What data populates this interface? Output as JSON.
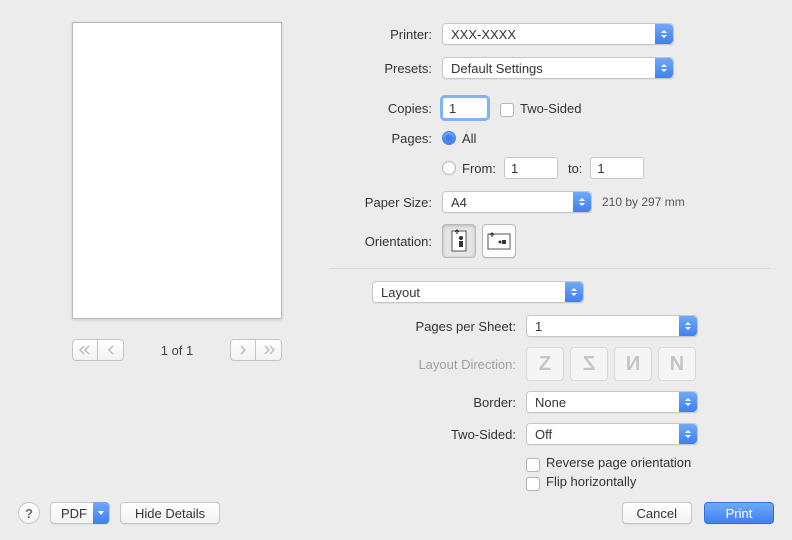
{
  "labels": {
    "printer": "Printer:",
    "presets": "Presets:",
    "copies": "Copies:",
    "two_sided_cb": "Two-Sided",
    "pages": "Pages:",
    "all": "All",
    "from": "From:",
    "to": "to:",
    "paper_size": "Paper Size:",
    "orientation": "Orientation:",
    "pages_per_sheet": "Pages per Sheet:",
    "layout_direction": "Layout Direction:",
    "border": "Border:",
    "two_sided": "Two-Sided:",
    "reverse": "Reverse page orientation",
    "flip": "Flip horizontally"
  },
  "values": {
    "printer": "XXX-XXXX",
    "presets": "Default Settings",
    "copies": "1",
    "from": "1",
    "to": "1",
    "paper_size": "A4",
    "paper_dims": "210 by 297 mm",
    "section": "Layout",
    "pages_per_sheet": "1",
    "border": "None",
    "two_sided": "Off"
  },
  "pager": {
    "label": "1 of 1"
  },
  "bottom": {
    "pdf": "PDF",
    "hide_details": "Hide Details",
    "cancel": "Cancel",
    "print": "Print"
  }
}
